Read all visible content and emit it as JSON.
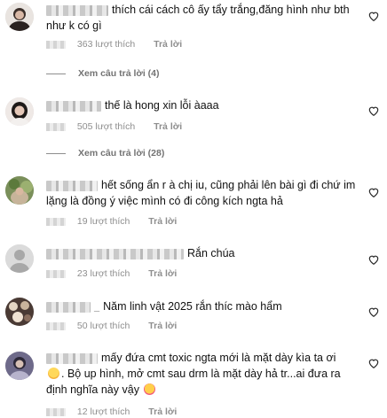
{
  "comments": [
    {
      "text": "thích cái cách cô ấy tẩy trắng,đăng hình như bth như k có gì",
      "likes": "363 lượt thích",
      "reply": "Trả lời",
      "view_replies": "Xem câu trả lời (4)"
    },
    {
      "text": "thế là hong xin lỗi àaaa",
      "likes": "505 lượt thích",
      "reply": "Trả lời",
      "view_replies": "Xem câu trả lời (28)"
    },
    {
      "text": "hết sống ẩn r à chị iu, cũng phải lên bài gì đi chứ im lặng là đồng ý việc mình có đi công kích ngta hả",
      "likes": "19 lượt thích",
      "reply": "Trả lời"
    },
    {
      "text": "Rắn chúa",
      "likes": "23 lượt thích",
      "reply": "Trả lời"
    },
    {
      "text": "Năm linh vật 2025 rắn thíc mào hẩm",
      "likes": "50 lượt thích",
      "reply": "Trả lời"
    },
    {
      "text_a": "mấy đứa cmt toxic ngta mới là mặt dày kìa ta ơi",
      "text_b": ". Bộ up hình, mở cmt sau drm là mặt dày hả tr...ai đưa ra định nghĩa này vậy",
      "likes": "12 lượt thích",
      "reply": "Trả lời"
    }
  ],
  "icons": {
    "heart": "heart-outline-icon",
    "emoji_grin": "grinning-squinting-face-emoji",
    "emoji_love": "smiling-face-with-hearts-emoji"
  },
  "colors": {
    "meta_text": "#8e8e8e",
    "heart_stroke": "#262626"
  }
}
